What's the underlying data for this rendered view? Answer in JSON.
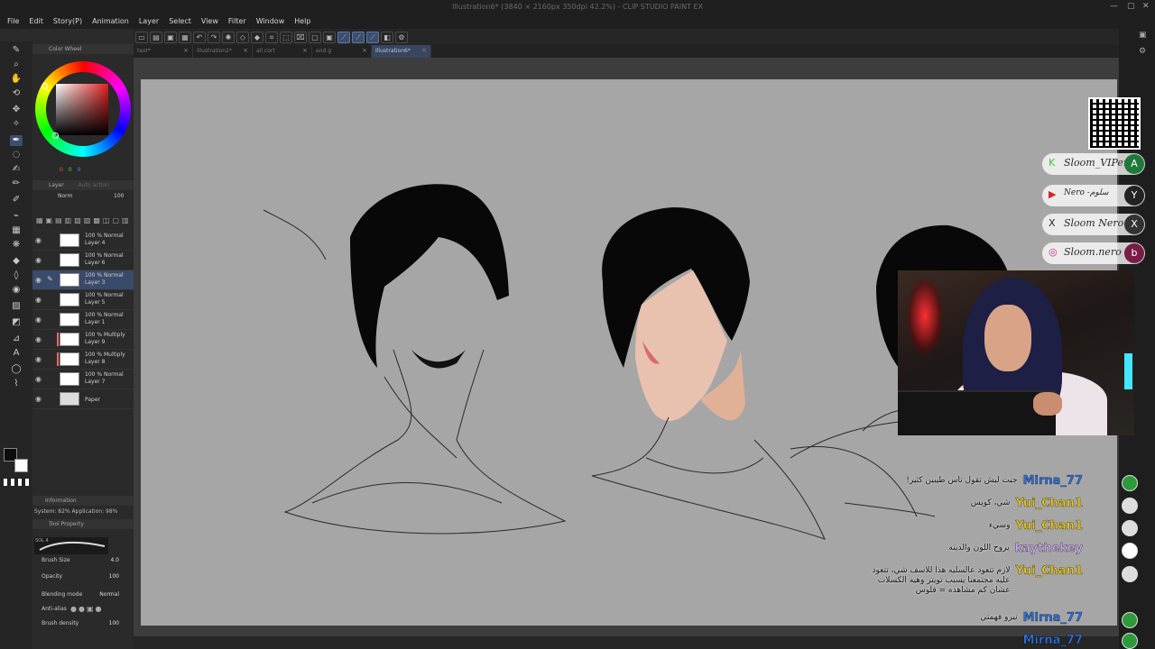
{
  "window": {
    "title": "Illustration6* (3840 × 2160px 350dpi 42.2%) - CLIP STUDIO PAINT EX"
  },
  "menu": [
    "File",
    "Edit",
    "Story(P)",
    "Animation",
    "Layer",
    "Select",
    "View",
    "Filter",
    "Window",
    "Help"
  ],
  "tabs": [
    {
      "label": "text*",
      "active": false
    },
    {
      "label": "Illustration2*",
      "active": false
    },
    {
      "label": "all cort",
      "active": false
    },
    {
      "label": "end g",
      "active": false
    },
    {
      "label": "Illustration6*",
      "active": true
    }
  ],
  "color_wheel": {
    "title": "Color Wheel",
    "rgb": [
      "0",
      "0",
      "0"
    ],
    "accent": "#e02020"
  },
  "layer_panel": {
    "title": "Layer",
    "search_placeholder": "Auto action",
    "blend": "Norm",
    "opacity": "100",
    "layers": [
      {
        "pct": "100 % Normal",
        "name": "Layer 4"
      },
      {
        "pct": "100 % Normal",
        "name": "Layer 6"
      },
      {
        "pct": "100 % Normal",
        "name": "Layer 3",
        "selected": true
      },
      {
        "pct": "100 % Normal",
        "name": "Layer 5"
      },
      {
        "pct": "100 % Normal",
        "name": "Layer 1"
      },
      {
        "pct": "100 % Multiply",
        "name": "Layer 9"
      },
      {
        "pct": "100 % Multiply",
        "name": "Layer 8"
      },
      {
        "pct": "100 % Normal",
        "name": "Layer 7"
      },
      {
        "pct": "",
        "name": "Paper"
      }
    ]
  },
  "info": {
    "title": "Information",
    "system": "System: 82%  Application: 98%"
  },
  "tool_property": {
    "title": "Tool Property",
    "brush_name": "SOL 4",
    "brush_size_label": "Brush Size",
    "brush_size": "4.0",
    "opacity_label": "Opacity",
    "opacity": "100",
    "blending_label": "Blending mode",
    "blending": "Normal",
    "antialias_label": "Anti-alias",
    "density_label": "Brush density",
    "density": "100"
  },
  "socials": [
    {
      "icon": "K",
      "label": "Sloom_VIPer",
      "badge": "A"
    },
    {
      "icon": "▶",
      "label": "Nero -سلوم",
      "badge": "Y"
    },
    {
      "icon": "X",
      "label": "Sloom Nero",
      "badge": "X"
    },
    {
      "icon": "◎",
      "label": "Sloom.nero",
      "badge": "b"
    }
  ],
  "chat": [
    {
      "user": "Mirna_77",
      "text": "!جبت ليش تقول تاس طيبين كثير",
      "color": "#2f6fd6"
    },
    {
      "user": "Yui_Chan1",
      "text": "شي، كويس",
      "color": "#e3c21b"
    },
    {
      "user": "Yui_Chan1",
      "text": "وسيء",
      "color": "#e3c21b"
    },
    {
      "user": "kaythekey",
      "text": "يروح اللون والدينه",
      "color": "#c7a6e6"
    },
    {
      "user": "Yui_Chan1",
      "text": "لازم تتعود عالسليه هذا للاسف شي، تتعود عليه مجتمعنا يسبب تويتر وهيه الكسلات عشان كم مشاهده = فلوس",
      "color": "#e3c21b"
    },
    {
      "user": "Mirna_77",
      "text": "نيرو فهمتي",
      "color": "#2f6fd6"
    },
    {
      "user": "Mirna_77",
      "text": "",
      "color": "#2f6fd6"
    }
  ],
  "colors": {
    "canvas": "#a6a6a6",
    "ui_dark": "#2a2a2a",
    "selection": "#3a4a6a"
  }
}
